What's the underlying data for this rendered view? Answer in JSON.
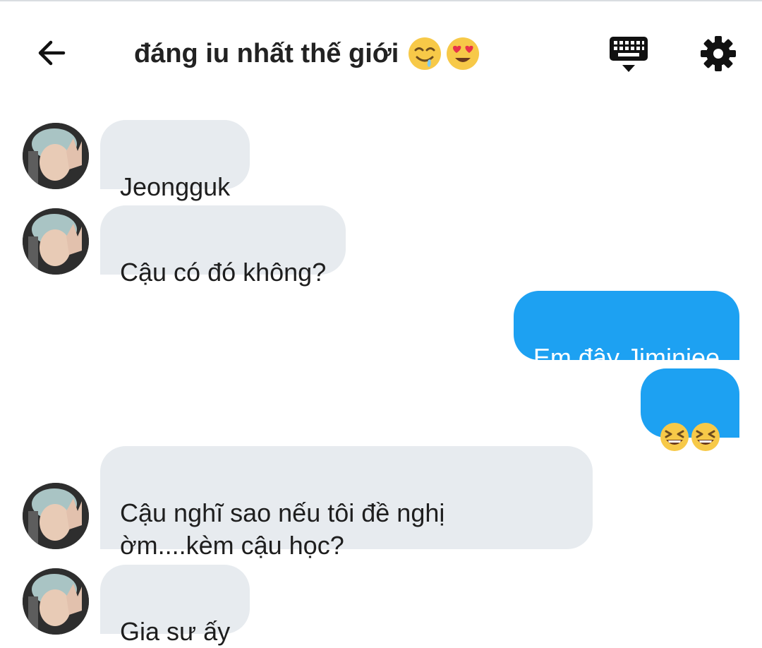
{
  "header": {
    "title": "đáng iu nhất thế giới",
    "title_emojis": [
      "drooling-face-emoji",
      "heart-eyes-emoji"
    ],
    "back_icon": "back-arrow-icon",
    "keyboard_icon": "keyboard-icon",
    "settings_icon": "gear-icon"
  },
  "colors": {
    "outgoing_bubble": "#1da1f2",
    "incoming_bubble": "#e7ebef"
  },
  "messages": [
    {
      "direction": "incoming",
      "text": "Jeongguk"
    },
    {
      "direction": "incoming",
      "text": "Cậu có đó không?"
    },
    {
      "direction": "outgoing",
      "text": "Em đây Jiminiee"
    },
    {
      "direction": "outgoing",
      "text": "",
      "emojis": [
        "grinning-squinting-emoji",
        "grinning-squinting-emoji"
      ]
    },
    {
      "direction": "incoming",
      "text": "Cậu nghĩ sao nếu tôi đề nghị\nờm....kèm cậu học?"
    },
    {
      "direction": "incoming",
      "text": "Gia sư ấy"
    }
  ]
}
